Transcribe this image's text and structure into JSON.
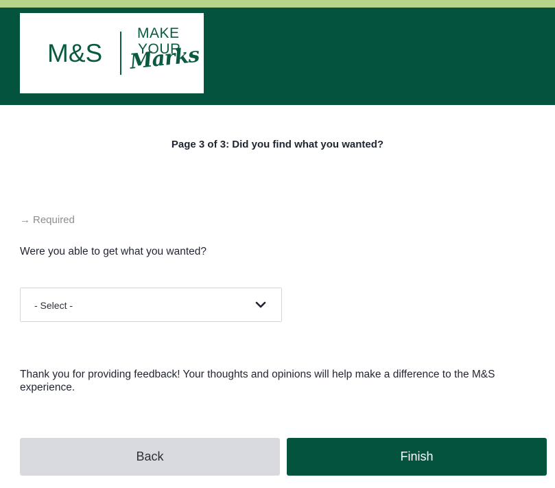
{
  "branding": {
    "logo_ms": "M&S",
    "tagline_line1": "MAKE",
    "tagline_line2": "YOUR",
    "tagline_line3": "Marks",
    "brand_green": "#04533f",
    "accent_strip": "#b6d58a"
  },
  "survey": {
    "page_title": "Page 3 of 3: Did you find what you wanted?",
    "required_label": "Required",
    "required_icon": "arrow-right-icon",
    "question": "Were you able to get what you wanted?",
    "select_value": "- Select -",
    "select_icon": "chevron-down-icon",
    "thank_you": "Thank you for providing feedback! Your thoughts and opinions will help make a difference to the M&S experience."
  },
  "buttons": {
    "back_label": "Back",
    "finish_label": "Finish"
  }
}
